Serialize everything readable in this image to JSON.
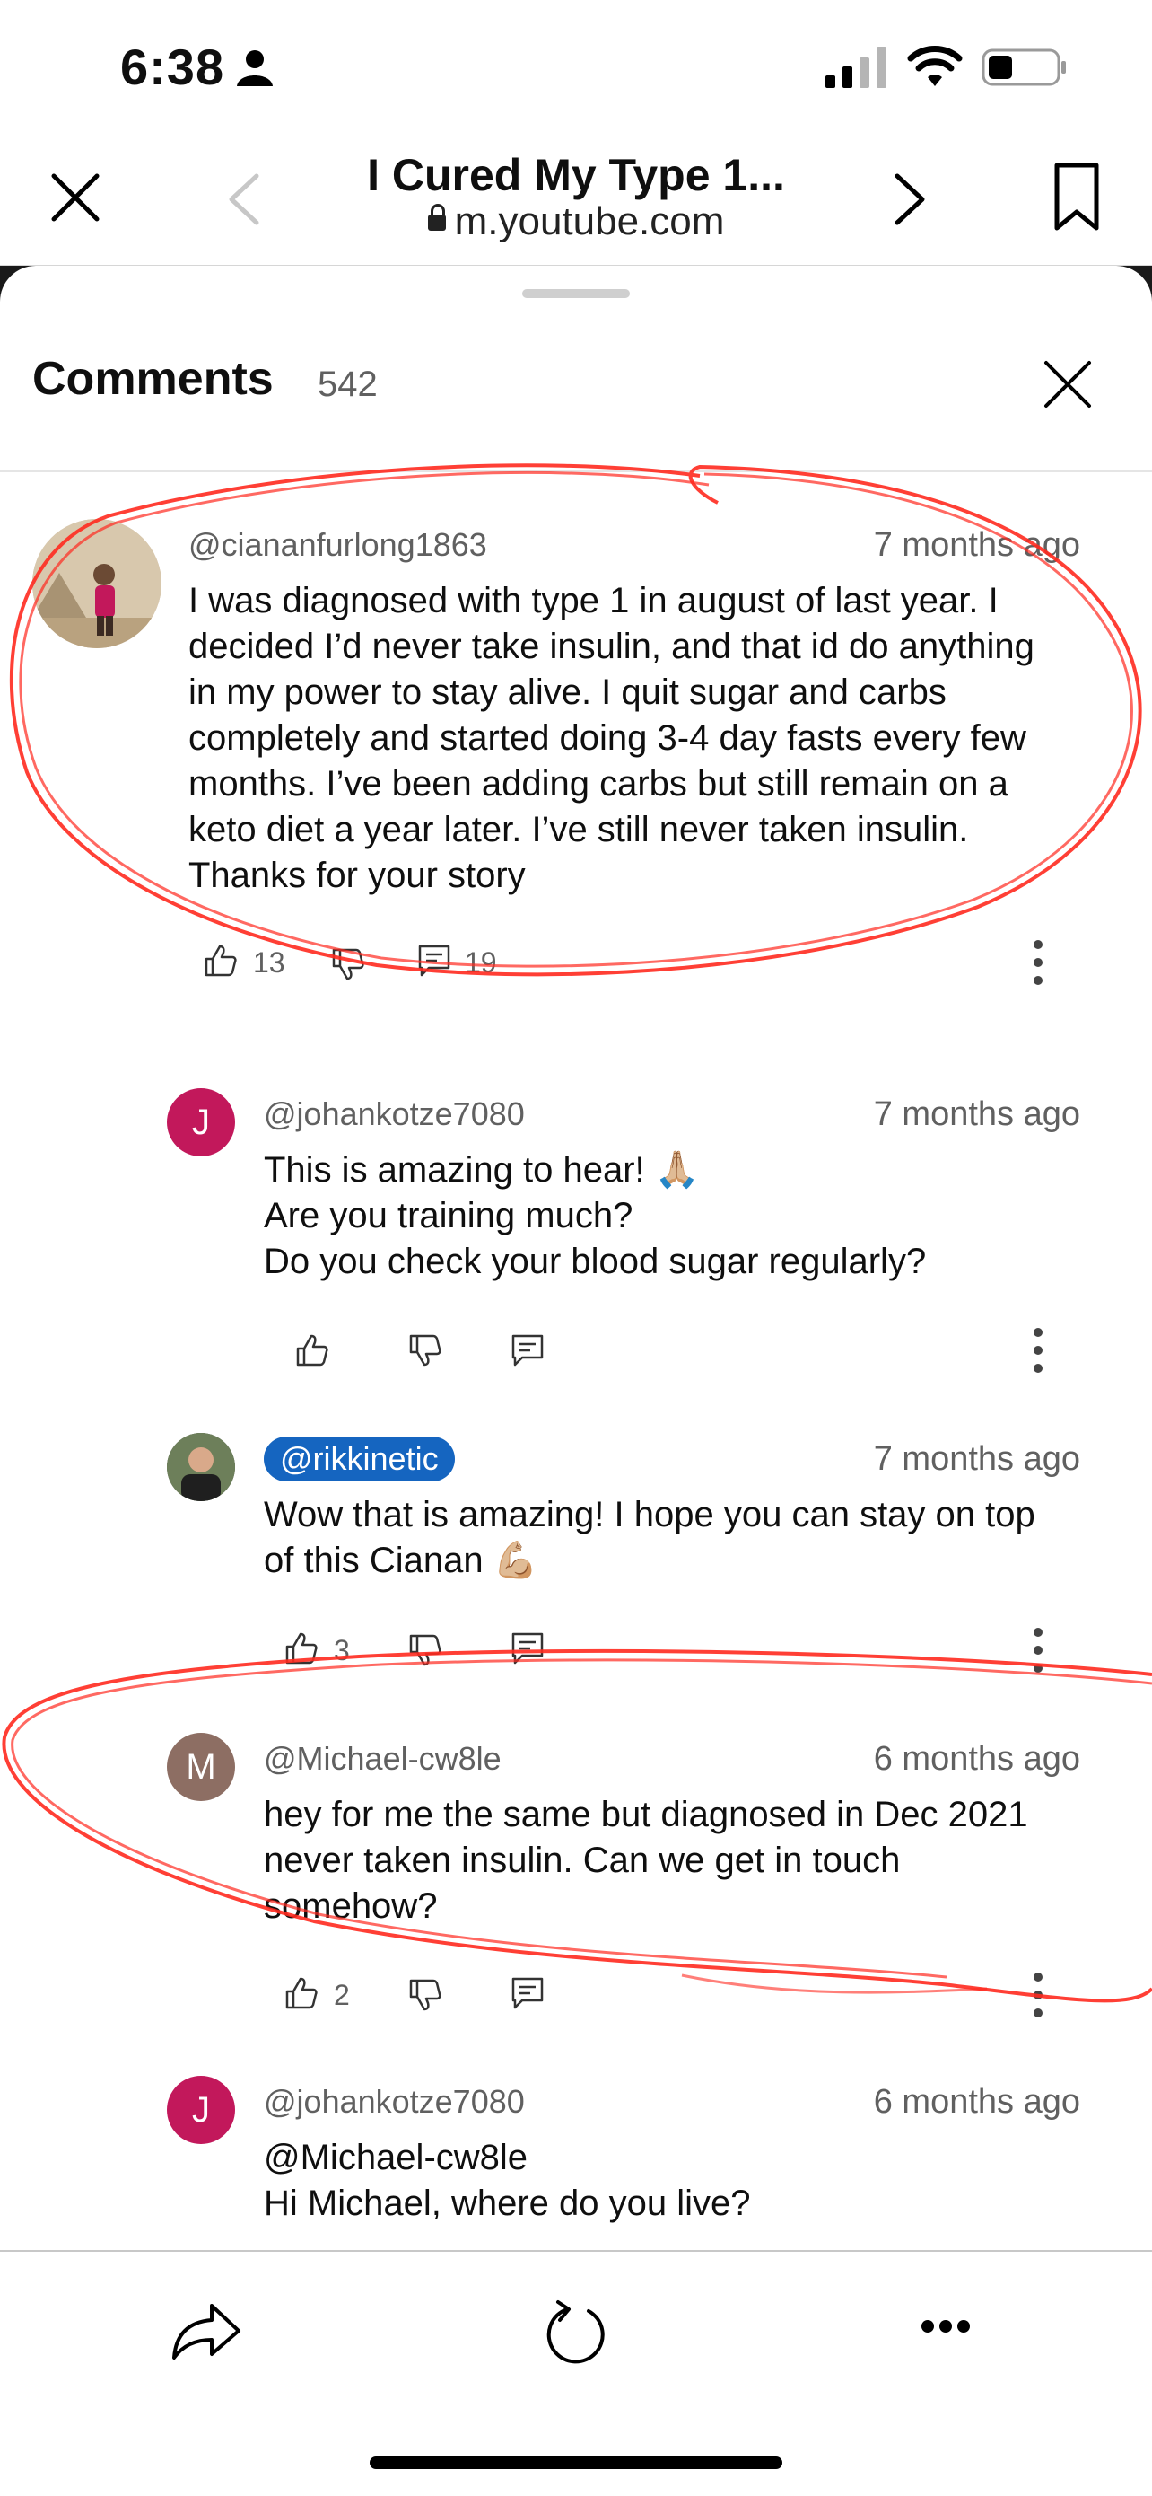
{
  "status_bar": {
    "time": "6:38"
  },
  "browser": {
    "page_title": "I Cured My Type 1...",
    "url": "m.youtube.com"
  },
  "comments_panel": {
    "title": "Comments",
    "count": "542"
  },
  "comments": [
    {
      "author": "@ciananfurlong1863",
      "time_ago": "7 months ago",
      "text": "I was diagnosed with type 1 in august of last year. I\ndecided I’d never take insulin, and that id do anything\nin my power to stay alive. I quit sugar and carbs\ncompletely and started doing 3-4 day fasts every few\nmonths. I’ve been adding carbs but still remain on a\nketo diet a year later. I’ve still never taken insulin.\nThanks for your story",
      "likes": "13",
      "replies": "19"
    },
    {
      "author": "@johankotze7080",
      "avatar_letter": "J",
      "avatar_color": "#c2185b",
      "time_ago": "7 months ago",
      "text": "This is amazing to hear! 🙏🏼\nAre you training much?\nDo you check your blood sugar regularly?"
    },
    {
      "author": "@rikkinetic",
      "time_ago": "7 months ago",
      "text": "Wow that is amazing! I hope you can stay on top\nof this Cianan 💪🏼",
      "likes": "3"
    },
    {
      "author": "@Michael-cw8le",
      "avatar_letter": "M",
      "avatar_color": "#8d6e63",
      "time_ago": "6 months ago",
      "text": "hey for me the same but diagnosed in Dec 2021\nnever taken insulin. Can we get in touch\nsomehow?",
      "likes": "2"
    },
    {
      "author": "@johankotze7080",
      "avatar_letter": "J",
      "avatar_color": "#c2185b",
      "time_ago": "6 months ago",
      "text": " @Michael-cw8le\nHi Michael, where do you live?"
    }
  ],
  "colors": {
    "annotation_red": "#ff2a1f",
    "mention_badge": "#1565c0"
  }
}
